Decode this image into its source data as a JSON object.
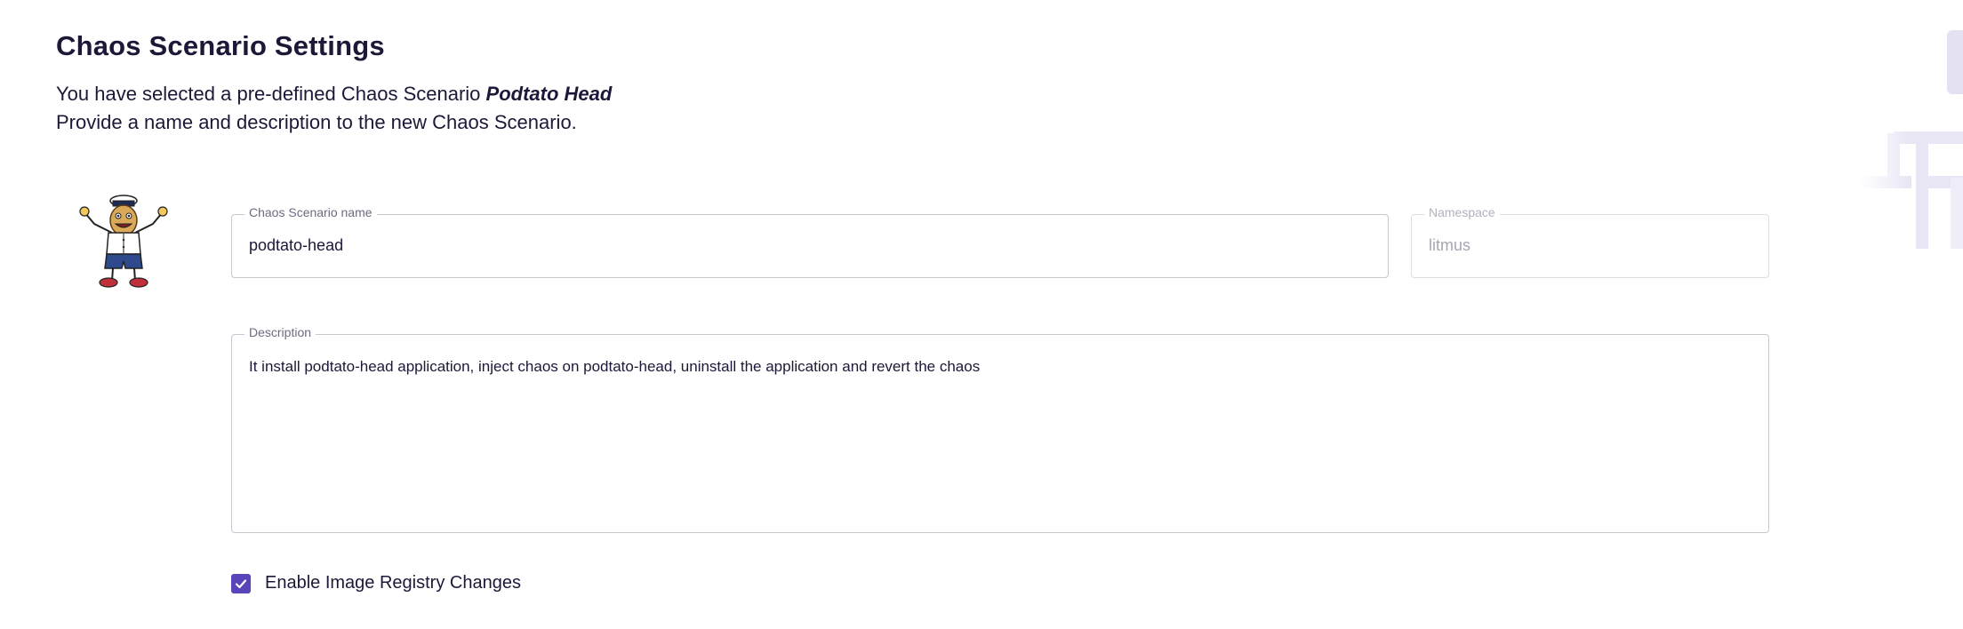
{
  "page": {
    "title": "Chaos Scenario Settings",
    "intro_prefix": "You have selected a pre-defined Chaos Scenario ",
    "intro_scenario": "Podtato Head",
    "intro_line2": "Provide a name and description to the new Chaos Scenario."
  },
  "form": {
    "name": {
      "label": "Chaos Scenario name",
      "value": "podtato-head"
    },
    "namespace": {
      "label": "Namespace",
      "value": "litmus",
      "disabled": true
    },
    "description": {
      "label": "Description",
      "value": "It install podtato-head application, inject chaos on podtato-head, uninstall the application  and revert the chaos"
    },
    "image_registry": {
      "label": "Enable Image Registry Changes",
      "checked": true
    }
  },
  "icons": {
    "mascot": "podtato-head-mascot-icon",
    "checkbox": "checkmark-icon"
  },
  "colors": {
    "text": "#1c1838",
    "accent": "#5b44ba",
    "border": "#c9c7d0"
  }
}
